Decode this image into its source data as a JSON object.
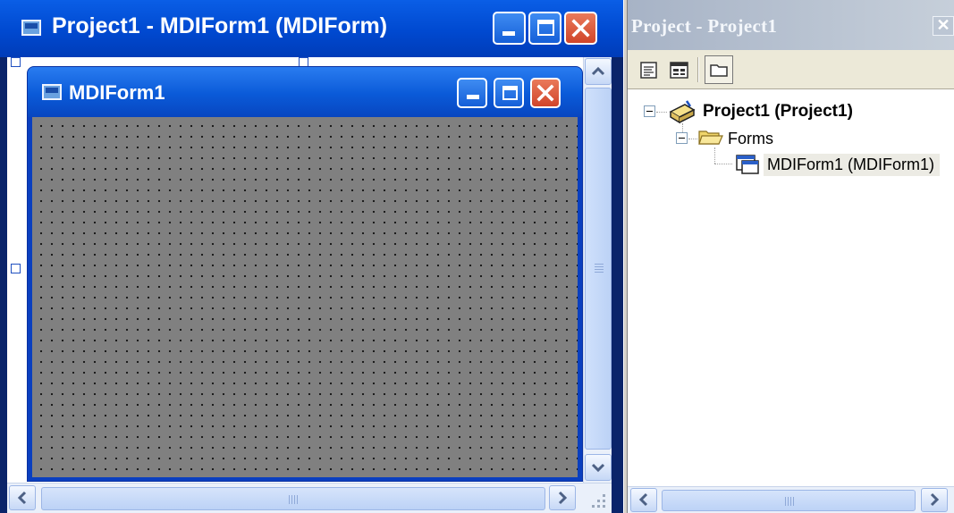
{
  "designer": {
    "title": "Project1 - MDIForm1 (MDIForm)",
    "icon": "form-icon",
    "window_buttons": [
      "minimize-icon",
      "maximize-icon",
      "close-icon"
    ]
  },
  "mdi_child": {
    "title": "MDIForm1",
    "icon": "form-icon",
    "window_buttons": [
      "minimize-icon",
      "maximize-icon",
      "close-icon"
    ],
    "client_color": "#808080"
  },
  "project_explorer": {
    "title": "Project - Project1",
    "close_glyph": "✕",
    "toolbar": [
      "view-code-icon",
      "view-object-icon",
      "toggle-folders-icon"
    ],
    "tree": {
      "project": "Project1 (Project1)",
      "folder": "Forms",
      "item": "MDIForm1 (MDIForm1)"
    }
  },
  "colors": {
    "xp_title_blue": "#0a5ee6",
    "inactive_title": "#a7b3c6",
    "close_red": "#e06040"
  }
}
